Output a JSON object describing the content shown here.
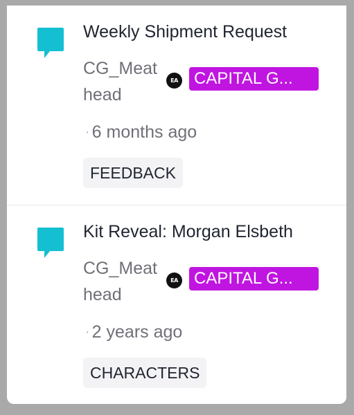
{
  "colors": {
    "icon": "#13bfd1",
    "role_badge": "#c015e0",
    "muted_text": "#6f6f78",
    "title_text": "#1f2430",
    "tag_bg": "#f3f3f5"
  },
  "items": [
    {
      "icon": "chat-bubble-icon",
      "title": "Weekly Shipment Request",
      "author": "CG_Meathead",
      "author_badge": "EA",
      "role": "CAPITAL G...",
      "time": "6 months ago",
      "tag": "FEEDBACK"
    },
    {
      "icon": "chat-bubble-icon",
      "title": "Kit Reveal: Morgan Elsbeth",
      "author": "CG_Meathead",
      "author_badge": "EA",
      "role": "CAPITAL G...",
      "time": "2 years ago",
      "tag": "CHARACTERS"
    }
  ],
  "time_prefix": "·"
}
